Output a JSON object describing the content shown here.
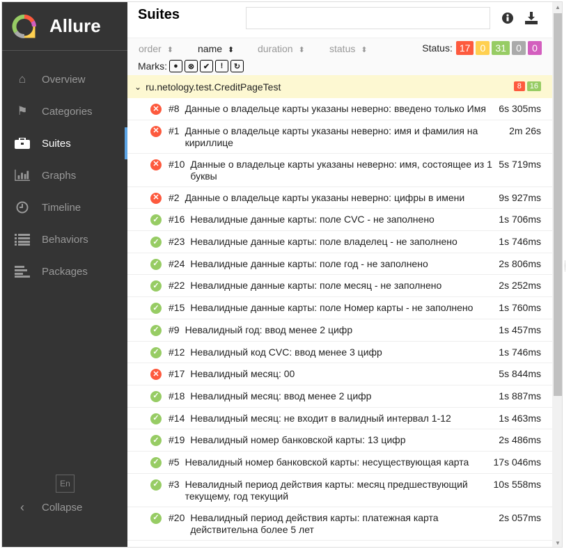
{
  "app": {
    "name": "Allure"
  },
  "sidebar": {
    "items": [
      {
        "label": "Overview",
        "icon": "home-icon"
      },
      {
        "label": "Categories",
        "icon": "flag-icon"
      },
      {
        "label": "Suites",
        "icon": "briefcase-icon",
        "active": true
      },
      {
        "label": "Graphs",
        "icon": "bar-chart-icon"
      },
      {
        "label": "Timeline",
        "icon": "clock-icon"
      },
      {
        "label": "Behaviors",
        "icon": "list-icon"
      },
      {
        "label": "Packages",
        "icon": "align-left-icon"
      }
    ],
    "lang": "En",
    "collapse": "Collapse"
  },
  "header": {
    "title": "Suites",
    "search_value": ""
  },
  "sort": {
    "order": "order",
    "name": "name",
    "duration": "duration",
    "status": "status"
  },
  "status": {
    "label": "Status:",
    "failed": "17",
    "broken": "0",
    "passed": "31",
    "skipped": "0",
    "unknown": "0"
  },
  "marks": {
    "label": "Marks:"
  },
  "colors": {
    "failed": "#fd5a3e",
    "broken": "#ffd050",
    "passed": "#97cc64",
    "skipped": "#aaaaaa",
    "unknown": "#d35ebe",
    "accent": "#5ba4e5"
  },
  "group": {
    "name": "ru.netology.test.CreditPageTest",
    "failed": "8",
    "passed": "16"
  },
  "tests": [
    {
      "status": "failed",
      "num": "#8",
      "name": "Данные о владельце карты указаны неверно: введено только Имя",
      "duration": "6s 305ms"
    },
    {
      "status": "failed",
      "num": "#1",
      "name": "Данные о владельце карты указаны неверно: имя и фамилия на кириллице",
      "duration": "2m 26s"
    },
    {
      "status": "failed",
      "num": "#10",
      "name": "Данные о владельце карты указаны неверно: имя, состоящее из 1 буквы",
      "duration": "5s 719ms"
    },
    {
      "status": "failed",
      "num": "#2",
      "name": "Данные о владельце карты указаны неверно: цифры в имени",
      "duration": "9s 927ms"
    },
    {
      "status": "passed",
      "num": "#16",
      "name": "Невалидные данные карты: поле CVC - не заполнено",
      "duration": "1s 706ms"
    },
    {
      "status": "passed",
      "num": "#23",
      "name": "Невалидные данные карты: поле владелец - не заполнено",
      "duration": "1s 746ms"
    },
    {
      "status": "passed",
      "num": "#24",
      "name": "Невалидные данные карты: поле год - не заполнено",
      "duration": "2s 806ms"
    },
    {
      "status": "passed",
      "num": "#22",
      "name": "Невалидные данные карты: поле месяц - не заполнено",
      "duration": "2s 252ms"
    },
    {
      "status": "passed",
      "num": "#15",
      "name": "Невалидные данные карты: поле Номер карты - не заполнено",
      "duration": "1s 760ms"
    },
    {
      "status": "passed",
      "num": "#9",
      "name": "Невалидный год: ввод менее 2 цифр",
      "duration": "1s 457ms"
    },
    {
      "status": "passed",
      "num": "#12",
      "name": "Невалидный код CVC: ввод менее 3 цифр",
      "duration": "1s 746ms"
    },
    {
      "status": "failed",
      "num": "#17",
      "name": "Невалидный месяц: 00",
      "duration": "5s 844ms"
    },
    {
      "status": "passed",
      "num": "#18",
      "name": "Невалидный месяц: ввод менее 2 цифр",
      "duration": "1s 887ms"
    },
    {
      "status": "passed",
      "num": "#14",
      "name": "Невалидный месяц: не входит в валидный интервал 1-12",
      "duration": "1s 463ms"
    },
    {
      "status": "passed",
      "num": "#19",
      "name": "Невалидный номер банковской карты: 13 цифр",
      "duration": "2s 486ms"
    },
    {
      "status": "passed",
      "num": "#5",
      "name": "Невалидный номер банковской карты: несуществующая карта",
      "duration": "17s 046ms"
    },
    {
      "status": "passed",
      "num": "#3",
      "name": "Невалидный период действия карты: месяц предшествующий текущему, год текущий",
      "duration": "10s 558ms"
    },
    {
      "status": "passed",
      "num": "#20",
      "name": "Невалидный период действия карты: платежная карта действительна более 5 лет",
      "duration": "2s 057ms"
    }
  ]
}
